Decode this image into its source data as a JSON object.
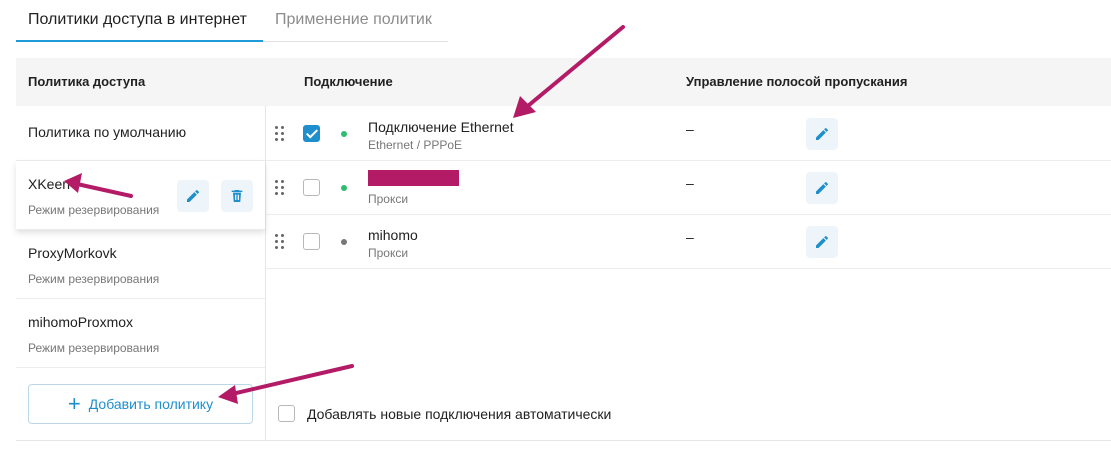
{
  "tabs": [
    {
      "label": "Политики доступа в интернет",
      "active": true
    },
    {
      "label": "Применение политик",
      "active": false
    }
  ],
  "sidebar": {
    "header": "Политика доступа",
    "policies": [
      {
        "name": "Политика по умолчанию",
        "mode": ""
      },
      {
        "name": "XKeen",
        "mode": "Режим резервирования"
      },
      {
        "name": "ProxyMorkovk",
        "mode": "Режим резервирования"
      },
      {
        "name": "mihomoProxmox",
        "mode": "Режим резервирования"
      }
    ],
    "add_label": "Добавить политику"
  },
  "table": {
    "col_connection": "Подключение",
    "col_bandwidth": "Управление полосой пропускания",
    "rows": [
      {
        "name": "Подключение Ethernet",
        "type": "Ethernet / PPPoE",
        "checked": true,
        "status": "connected",
        "bandwidth": "–"
      },
      {
        "name": "",
        "type": "Прокси",
        "checked": false,
        "status": "connected",
        "bandwidth": "–",
        "redacted": true
      },
      {
        "name": "mihomo",
        "type": "Прокси",
        "checked": false,
        "status": "disconnected",
        "bandwidth": "–"
      }
    ]
  },
  "auto_add_label": "Добавлять новые подключения автоматически",
  "colors": {
    "accent": "#1e8fcc",
    "status_connected": "#2dbd6e",
    "status_disconnected": "#777777",
    "annotation": "#b31b66"
  },
  "icons": [
    "drag-handle-icon",
    "pencil-icon",
    "trash-icon",
    "plus-icon",
    "check-icon"
  ]
}
